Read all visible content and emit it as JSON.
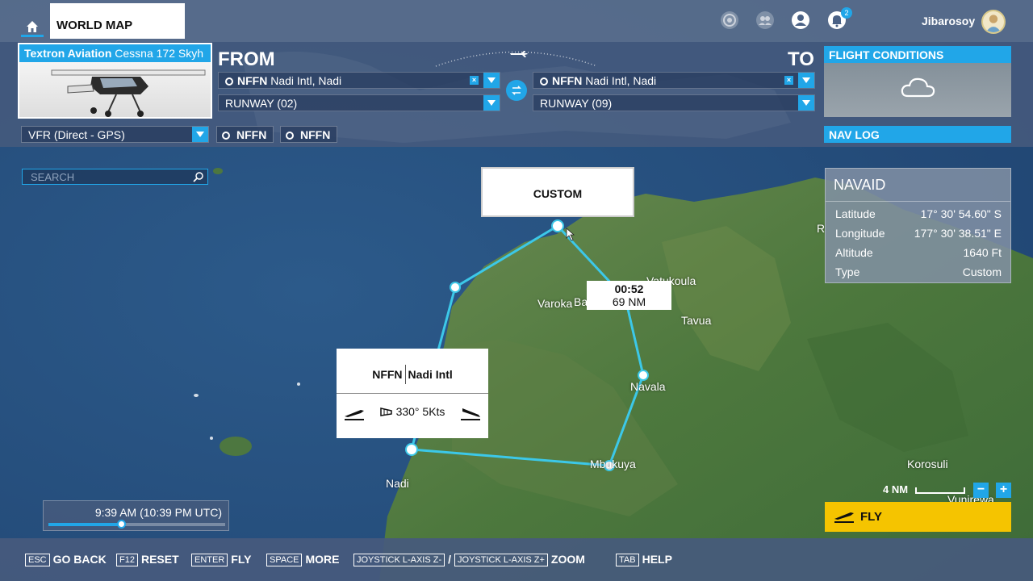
{
  "topbar": {
    "title": "WORLD MAP",
    "username": "Jibarosoy",
    "notification_count": "2",
    "icons": [
      "home-icon",
      "activity-icon",
      "friends-icon",
      "profile-icon",
      "bell-icon"
    ]
  },
  "aircraft": {
    "brand": "Textron Aviation",
    "model": "Cessna 172 Skyh"
  },
  "from": {
    "label": "FROM",
    "airport_code": "NFFN",
    "airport_name": "Nadi Intl, Nadi",
    "runway": "RUNWAY (02)"
  },
  "to": {
    "label": "TO",
    "airport_code": "NFFN",
    "airport_name": "Nadi Intl, Nadi",
    "runway": "RUNWAY (09)"
  },
  "flight_conditions": {
    "title": "FLIGHT CONDITIONS",
    "icon": "cloud-icon"
  },
  "flightplan": {
    "type": "VFR (Direct - GPS)",
    "departure_waypoint": "NFFN",
    "arrival_waypoint": "NFFN"
  },
  "navlog": {
    "title": "NAV LOG"
  },
  "search": {
    "placeholder": "SEARCH"
  },
  "navaid": {
    "title": "NAVAID",
    "rows": [
      {
        "label": "Latitude",
        "value": "17° 30' 54.60\" S"
      },
      {
        "label": "Longitude",
        "value": "177° 30' 38.51\" E"
      },
      {
        "label": "Altitude",
        "value": "1640 Ft"
      },
      {
        "label": "Type",
        "value": "Custom"
      }
    ]
  },
  "map": {
    "custom_label": "CUSTOM",
    "leg": {
      "time": "00:52",
      "distance": "69 NM"
    },
    "airport_popup": {
      "code": "NFFN",
      "name": "Nadi Intl",
      "wind": "330° 5Kts"
    },
    "places": [
      "Varoka",
      "Ba",
      "Vatukoula",
      "Tavua",
      "Navala",
      "Mbukuya",
      "Nadi",
      "Korosuli",
      "Vunirewa",
      "R"
    ]
  },
  "time": {
    "display": "9:39 AM (10:39 PM UTC)",
    "progress": 0.41
  },
  "scale": {
    "label": "4 NM"
  },
  "zoom": {
    "minus": "−",
    "plus": "+"
  },
  "fly": {
    "label": "FLY"
  },
  "hotkeys": [
    {
      "key": "ESC",
      "action": "GO BACK"
    },
    {
      "key": "F12",
      "action": "RESET"
    },
    {
      "key": "ENTER",
      "action": "FLY"
    },
    {
      "key": "SPACE",
      "action": "MORE"
    },
    {
      "key": "JOYSTICK L-AXIS Z-",
      "sep": "/",
      "key2": "JOYSTICK L-AXIS Z+",
      "action": "ZOOM"
    },
    {
      "key": "TAB",
      "action": "HELP"
    }
  ],
  "colors": {
    "accent": "#21a6e8",
    "fly": "#f5c400",
    "route": "#3cc8e8"
  }
}
